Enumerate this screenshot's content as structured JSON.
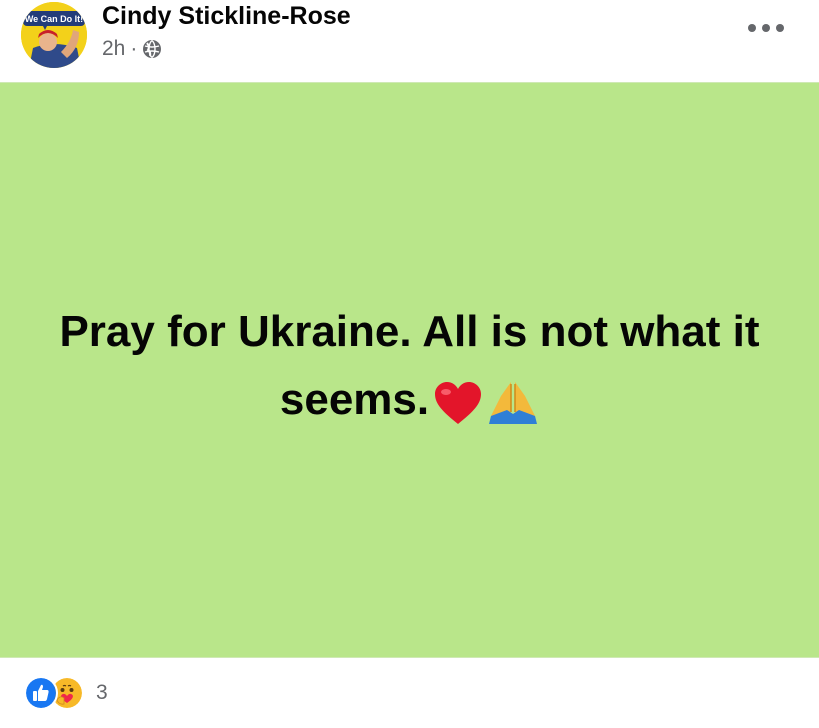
{
  "post": {
    "author": "Cindy Stickline-Rose",
    "timestamp": "2h",
    "separator": "·",
    "audience_icon": "globe-icon",
    "avatar_text": "We Can Do It!",
    "more_icon": "more-options-icon",
    "text": "Pray for Ukraine. All is not what it seems.",
    "text_emojis": [
      "heart-emoji",
      "praying-hands-emoji"
    ],
    "background_color": "#b9e68a",
    "reactions": {
      "icons": [
        "like-reaction-icon",
        "care-reaction-icon"
      ],
      "count": "3"
    }
  },
  "colors": {
    "text_primary": "#050505",
    "text_secondary": "#65676b",
    "like_blue": "#1877f2"
  }
}
